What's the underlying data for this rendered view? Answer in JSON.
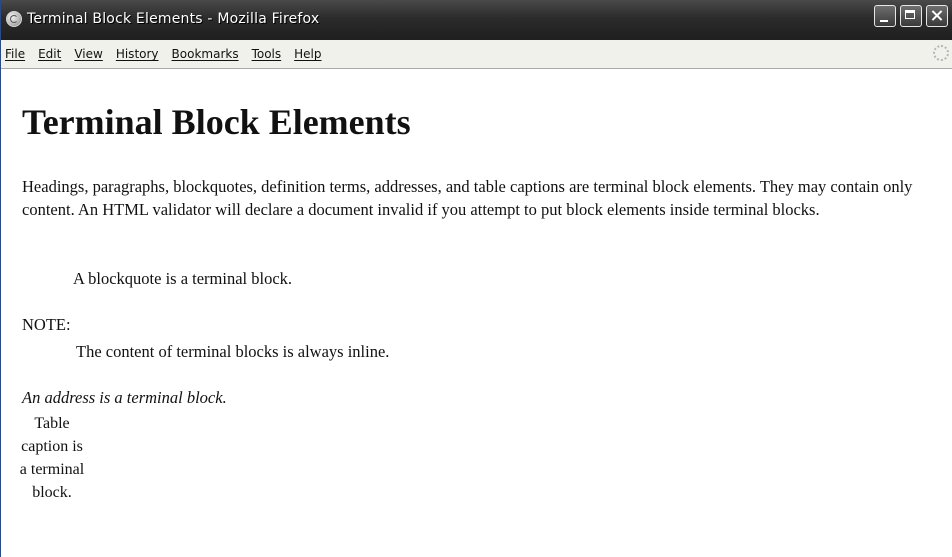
{
  "window": {
    "title": "Terminal Block Elements - Mozilla Firefox",
    "icon": "firefox-icon"
  },
  "menubar": {
    "items": [
      "File",
      "Edit",
      "View",
      "History",
      "Bookmarks",
      "Tools",
      "Help"
    ]
  },
  "page": {
    "heading": "Terminal Block Elements",
    "intro": "Headings, paragraphs, blockquotes, definition terms, addresses, and table captions are terminal block elements. They may contain only content. An HTML validator will declare a document invalid if you attempt to put block elements inside terminal blocks.",
    "blockquote": "A blockquote is a terminal block.",
    "definition_term": "NOTE:",
    "definition_desc": "The content of terminal blocks is always inline.",
    "address": "An address is a terminal block.",
    "table_caption": "Table caption is a terminal block."
  }
}
